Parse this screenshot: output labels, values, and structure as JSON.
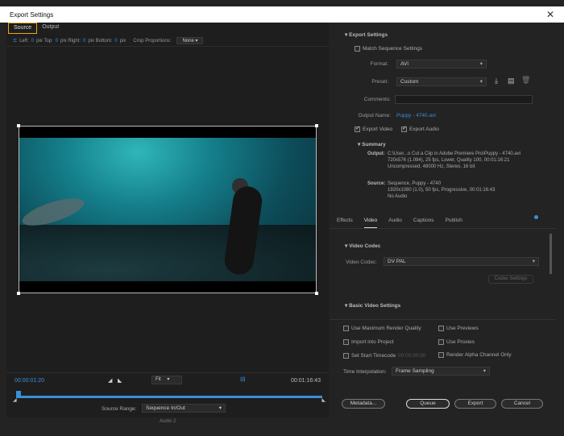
{
  "window": {
    "title": "Export Settings",
    "close": "✕"
  },
  "left": {
    "tabs": [
      {
        "label": "Source"
      },
      {
        "label": "Output"
      }
    ],
    "crop": {
      "left_label": "Left:",
      "left_val": "0",
      "top_label": "pix Top:",
      "top_val": "0",
      "right_label": "pix Right:",
      "right_val": "0",
      "bottom_label": "pix Bottom:",
      "bottom_val": "0",
      "pix": "pix",
      "proportions_label": "Crop Proportions:",
      "proportions_val": "None"
    },
    "timeline": {
      "current": "00:00:01:20",
      "end": "00:01:16:43",
      "fit": "Fit",
      "source_range_label": "Source Range:",
      "source_range": "Sequence In/Out"
    }
  },
  "export": {
    "header": "Export Settings",
    "match": "Match Sequence Settings",
    "format_label": "Format:",
    "format": "AVI",
    "preset_label": "Preset:",
    "preset": "Custom",
    "comments_label": "Comments:",
    "output_name_label": "Output Name:",
    "output_name": "Puppy - 4740.avi",
    "export_video": "Export Video",
    "export_audio": "Export Audio",
    "summary_header": "Summary",
    "output_label": "Output:",
    "output_lines": [
      "C:\\User...o Cut a Clip in Adobe Premiere Pro\\Puppy - 4740.avi",
      "720x576 (1.094), 25 fps, Lower, Quality 100, 00:01:16:21",
      "Uncompressed, 48000 Hz, Stereo, 16 bit"
    ],
    "source_label": "Source:",
    "source_lines": [
      "Sequence, Puppy - 4740",
      "1920x1080 (1.0), 50 fps, Progressive, 00:01:16:43",
      "No Audio"
    ]
  },
  "tabs": [
    {
      "label": "Effects"
    },
    {
      "label": "Video"
    },
    {
      "label": "Audio"
    },
    {
      "label": "Captions"
    },
    {
      "label": "Publish"
    }
  ],
  "video": {
    "codec_header": "Video Codec",
    "codec_label": "Video Codec:",
    "codec": "DV PAL",
    "codec_settings": "Codec Settings",
    "basic_header": "Basic Video Settings"
  },
  "options": {
    "max_render": "Use Maximum Render Quality",
    "use_previews": "Use Previews",
    "import_project": "Import into Project",
    "use_proxies": "Use Proxies",
    "set_start": "Set Start Timecode",
    "start_tc": "00:00:00:00",
    "render_alpha": "Render Alpha Channel Only",
    "interp_label": "Time Interpolation:",
    "interp": "Frame Sampling"
  },
  "buttons": {
    "metadata": "Metadata...",
    "queue": "Queue",
    "export": "Export",
    "cancel": "Cancel"
  },
  "misc": {
    "track_label": "Audio 2"
  }
}
